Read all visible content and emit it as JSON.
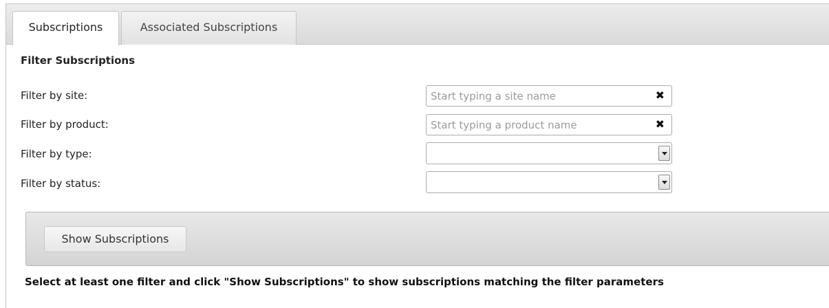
{
  "tabs": [
    {
      "label": "Subscriptions",
      "active": true
    },
    {
      "label": "Associated Subscriptions",
      "active": false
    }
  ],
  "filter_section": {
    "title": "Filter Subscriptions",
    "site": {
      "label": "Filter by site:",
      "value": "",
      "placeholder": "Start typing a site name",
      "clear_icon": "close-icon"
    },
    "product": {
      "label": "Filter by product:",
      "value": "",
      "placeholder": "Start typing a product name",
      "clear_icon": "close-icon"
    },
    "type": {
      "label": "Filter by type:",
      "selected": ""
    },
    "status": {
      "label": "Filter by status:",
      "selected": ""
    }
  },
  "actions": {
    "show_label": "Show Subscriptions"
  },
  "hint": "Select at least one filter and click \"Show Subscriptions\" to show subscriptions matching the filter parameters",
  "colors": {
    "tab_bar": "#dadada",
    "border": "#c5c5c5",
    "action_bar": "#d4d4d4",
    "placeholder": "#9a9a9a"
  }
}
